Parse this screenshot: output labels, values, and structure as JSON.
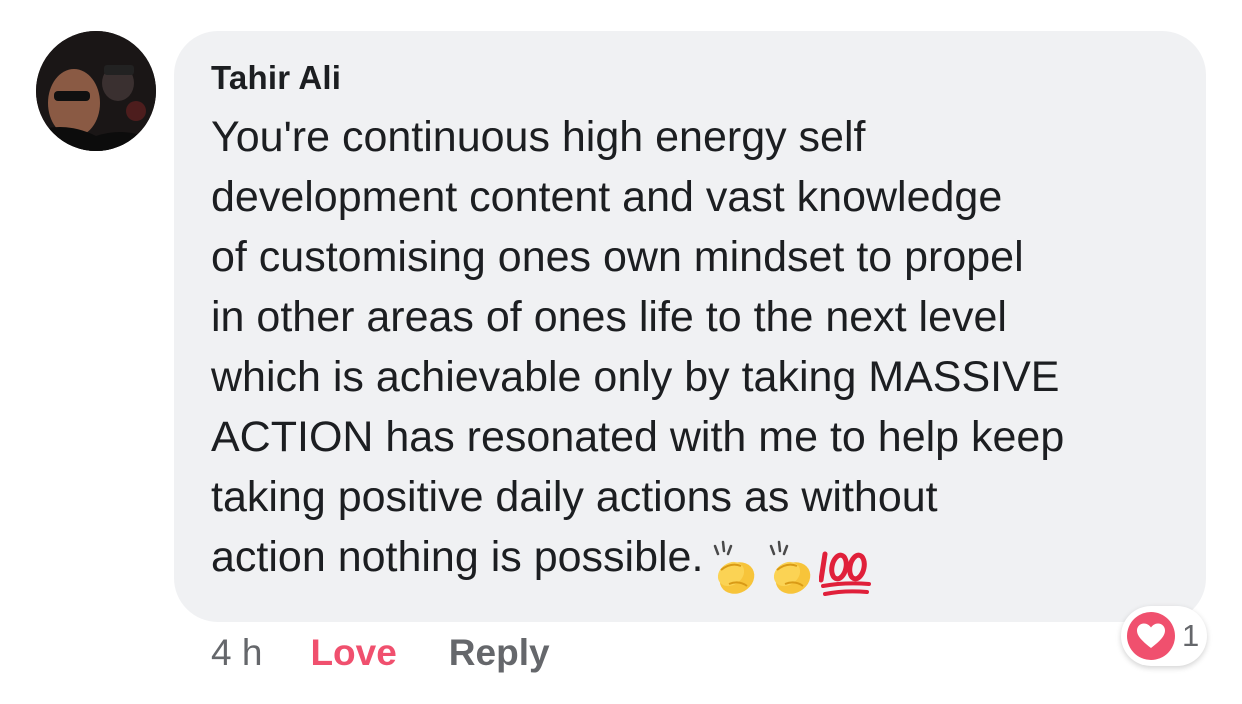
{
  "comment": {
    "author": "Tahir Ali",
    "text": "You're continuous high energy self\ndevelopment content and vast knowledge\nof customising ones own mindset to propel\nin other areas of ones life to the next level\nwhich is achievable only by taking MASSIVE\nACTION has resonated with me to help keep\ntaking positive daily actions as without\naction nothing is possible.",
    "emojis": [
      "clapping-hands-emoji",
      "clapping-hands-emoji",
      "hundred-points-emoji"
    ]
  },
  "actions": {
    "time": "4 h",
    "love_label": "Love",
    "reply_label": "Reply"
  },
  "reactions": {
    "type": "love",
    "count": "1"
  },
  "colors": {
    "bubble": "#f0f1f3",
    "love": "#f0506e",
    "muted": "#65676b",
    "text": "#1c1e21"
  }
}
